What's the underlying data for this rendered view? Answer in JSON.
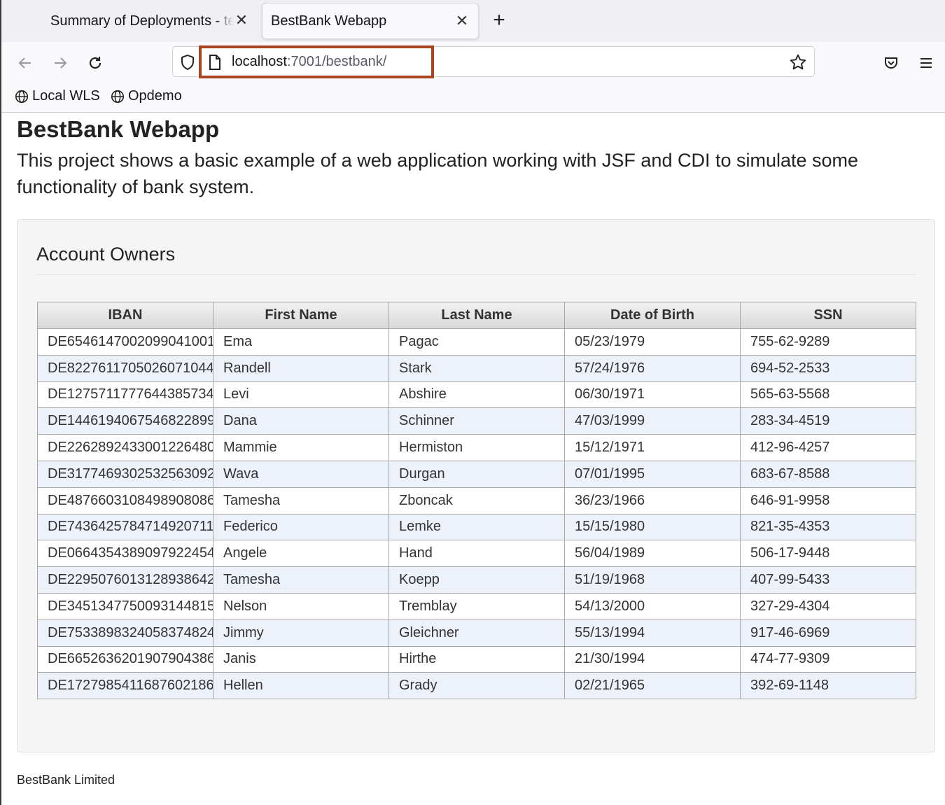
{
  "browser": {
    "tabs": [
      {
        "title": "Summary of Deployments - te",
        "active": false
      },
      {
        "title": "BestBank Webapp",
        "active": true
      }
    ],
    "url_host": "localhost",
    "url_rest": ":7001/bestbank/",
    "bookmarks": [
      "Local WLS",
      "Opdemo"
    ]
  },
  "page": {
    "title": "BestBank Webapp",
    "intro": "This project shows a basic example of a web application working with JSF and CDI to simulate some functionality of bank system.",
    "panel_title": "Account Owners",
    "footer": "BestBank Limited"
  },
  "table": {
    "headers": [
      "IBAN",
      "First Name",
      "Last Name",
      "Date of Birth",
      "SSN"
    ],
    "rows": [
      [
        "DE6546147002099041001",
        "Ema",
        "Pagac",
        "05/23/1979",
        "755-62-9289"
      ],
      [
        "DE8227611705026071044",
        "Randell",
        "Stark",
        "57/24/1976",
        "694-52-2533"
      ],
      [
        "DE1275711777644385734",
        "Levi",
        "Abshire",
        "06/30/1971",
        "565-63-5568"
      ],
      [
        "DE1446194067546822899",
        "Dana",
        "Schinner",
        "47/03/1999",
        "283-34-4519"
      ],
      [
        "DE2262892433001226480",
        "Mammie",
        "Hermiston",
        "15/12/1971",
        "412-96-4257"
      ],
      [
        "DE3177469302532563092",
        "Wava",
        "Durgan",
        "07/01/1995",
        "683-67-8588"
      ],
      [
        "DE4876603108498908086",
        "Tamesha",
        "Zboncak",
        "36/23/1966",
        "646-91-9958"
      ],
      [
        "DE7436425784714920711",
        "Federico",
        "Lemke",
        "15/15/1980",
        "821-35-4353"
      ],
      [
        "DE0664354389097922454",
        "Angele",
        "Hand",
        "56/04/1989",
        "506-17-9448"
      ],
      [
        "DE2295076013128938642",
        "Tamesha",
        "Koepp",
        "51/19/1968",
        "407-99-5433"
      ],
      [
        "DE3451347750093144815",
        "Nelson",
        "Tremblay",
        "54/13/2000",
        "327-29-4304"
      ],
      [
        "DE7533898324058374824",
        "Jimmy",
        "Gleichner",
        "55/13/1994",
        "917-46-6969"
      ],
      [
        "DE6652636201907904386",
        "Janis",
        "Hirthe",
        "21/30/1994",
        "474-77-9309"
      ],
      [
        "DE1727985411687602186",
        "Hellen",
        "Grady",
        "02/21/1965",
        "392-69-1148"
      ]
    ]
  }
}
